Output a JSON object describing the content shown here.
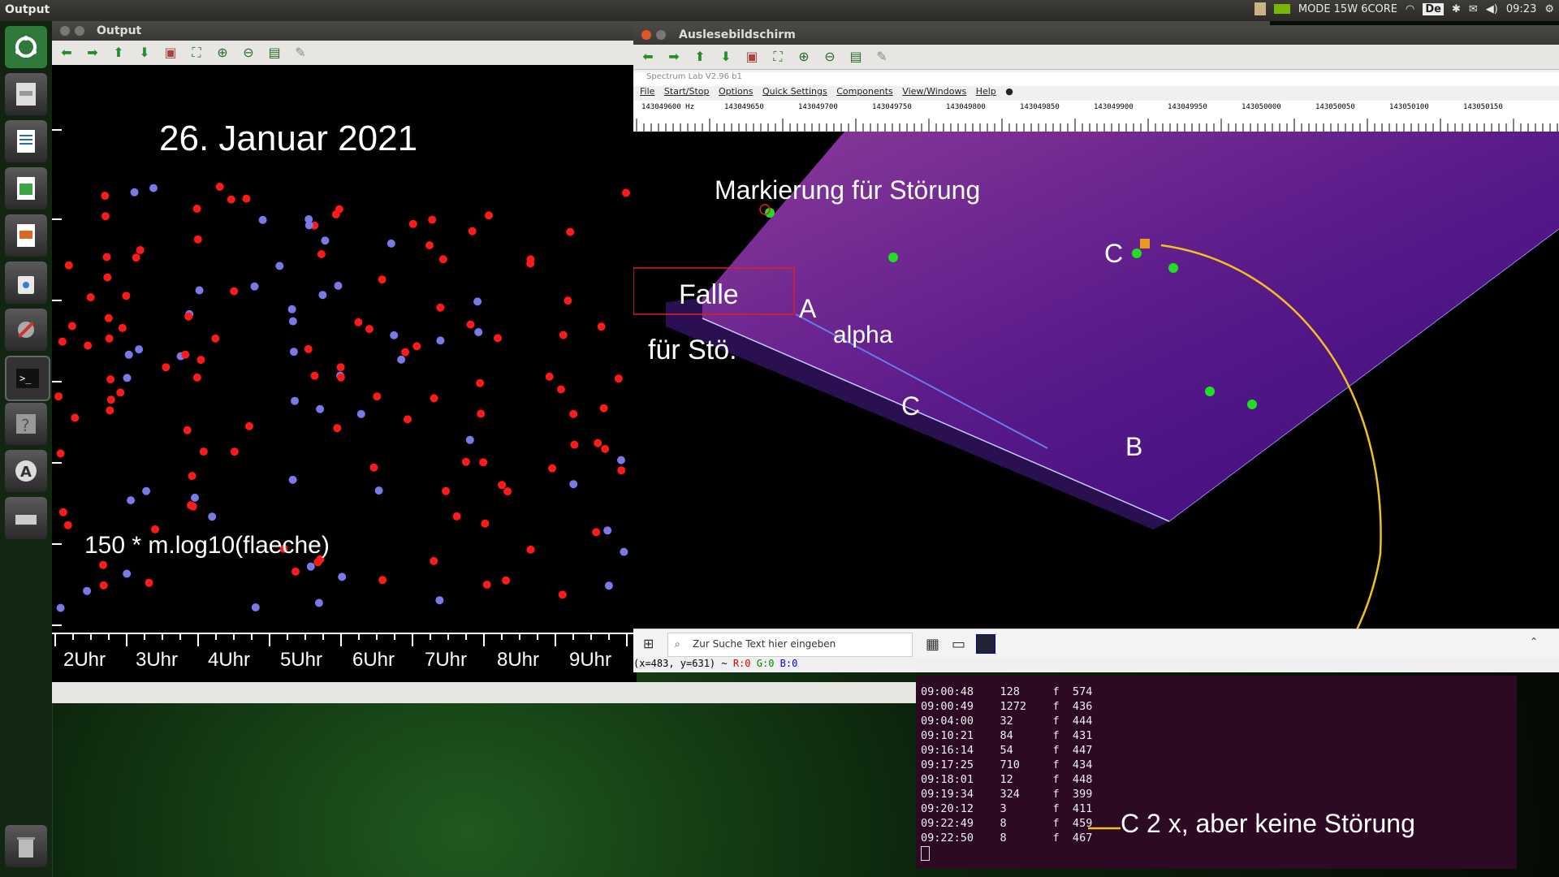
{
  "topbar": {
    "app_title": "Output",
    "mode_label": "MODE 15W 6CORE",
    "keyboard_layout": "De",
    "clock": "09:23"
  },
  "output_window": {
    "title": "Output",
    "plot_title": "26. Januar 2021",
    "formula": "150 * m.log10(flaeche)",
    "x_ticks": [
      "2Uhr",
      "3Uhr",
      "4Uhr",
      "5Uhr",
      "6Uhr",
      "7Uhr",
      "8Uhr",
      "9Uhr"
    ]
  },
  "auslese_window": {
    "title": "Auslesebildschirm",
    "spectrum_title": "Spectrum Lab V2.96 b1",
    "menu": [
      "File",
      "Start/Stop",
      "Options",
      "Quick Settings",
      "Components",
      "View/Windows",
      "Help"
    ],
    "freq_ticks": [
      "143049600 Hz",
      "143049650",
      "143049700",
      "143049750",
      "143049800",
      "143049850",
      "143049900",
      "143049950",
      "143050000",
      "143050050",
      "143050100",
      "143050150"
    ],
    "annotations": {
      "marker": "Markierung für Störung",
      "falle": "Falle",
      "fuer_stoe": "für Stö.",
      "a": "A",
      "alpha": "alpha",
      "c_low": "C",
      "b": "B",
      "c_top": "C"
    },
    "search_placeholder": "Zur Suche Text hier eingeben",
    "coords": "(x=483, y=631) ~",
    "rgb": {
      "r": "R:0",
      "g": "G:0",
      "b": "B:0"
    }
  },
  "terminal": {
    "lines": [
      [
        "09:00:48",
        "128",
        "f",
        "574"
      ],
      [
        "09:00:49",
        "1272",
        "f",
        "436"
      ],
      [
        "09:04:00",
        "32",
        "f",
        "444"
      ],
      [
        "09:10:21",
        "84",
        "f",
        "431"
      ],
      [
        "09:16:14",
        "54",
        "f",
        "447"
      ],
      [
        "09:17:25",
        "710",
        "f",
        "434"
      ],
      [
        "09:18:01",
        "12",
        "f",
        "448"
      ],
      [
        "09:19:34",
        "324",
        "f",
        "399"
      ],
      [
        "09:20:12",
        "3",
        "f",
        "411"
      ],
      [
        "09:22:49",
        "8",
        "f",
        "459"
      ],
      [
        "09:22:50",
        "8",
        "f",
        "467"
      ]
    ],
    "annotation": "C 2 x, aber keine Störung"
  },
  "colors": {
    "red_dot": "#ff1a1a",
    "blue_dot": "#7b78e8",
    "yellow_line": "#f0c020",
    "green_marker": "#22dd22"
  }
}
